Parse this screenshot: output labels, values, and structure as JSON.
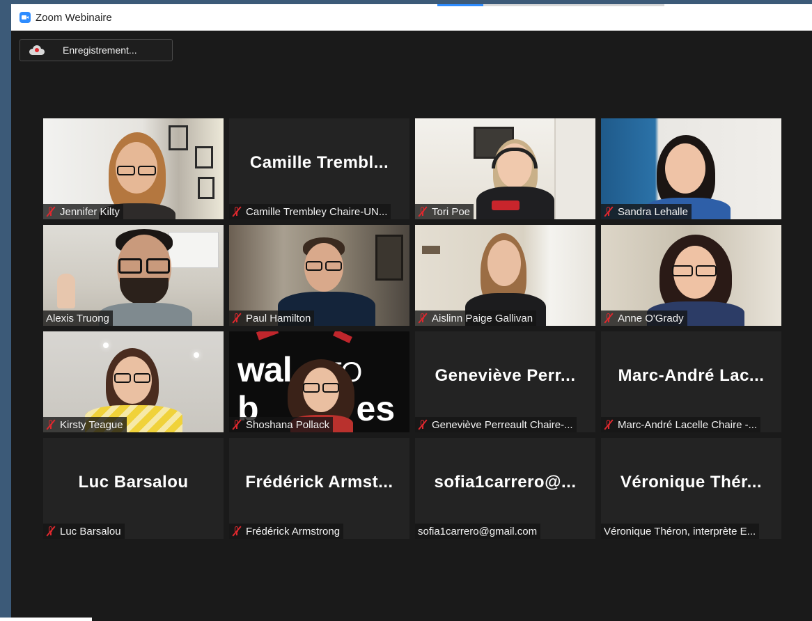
{
  "window": {
    "title": "Zoom Webinaire"
  },
  "recording": {
    "label": "Enregistrement..."
  },
  "participants": [
    {
      "name": "Jennifer Kilty",
      "video": true,
      "muted": true
    },
    {
      "display": "Camille Trembl...",
      "name": "Camille Trembley Chaire-UN...",
      "video": false,
      "muted": true
    },
    {
      "name": "Tori Poe",
      "video": true,
      "muted": true
    },
    {
      "name": "Sandra Lehalle",
      "video": true,
      "muted": true
    },
    {
      "name": "Alexis Truong",
      "video": true,
      "muted": false,
      "active_speaker": true
    },
    {
      "name": "Paul Hamilton",
      "video": true,
      "muted": true
    },
    {
      "name": "Aislinn Paige Gallivan",
      "video": true,
      "muted": true
    },
    {
      "name": "Anne O'Grady",
      "video": true,
      "muted": true
    },
    {
      "name": "Kirsty Teague",
      "video": true,
      "muted": true
    },
    {
      "name": "Shoshana Pollack",
      "video": true,
      "muted": true,
      "background_text": "walls TO bridges"
    },
    {
      "display": "Geneviève  Perr...",
      "name": "Geneviève Perreault Chaire-...",
      "video": false,
      "muted": true
    },
    {
      "display": "Marc-André  Lac...",
      "name": "Marc-André Lacelle Chaire -...",
      "video": false,
      "muted": true
    },
    {
      "display": "Luc Barsalou",
      "name": "Luc Barsalou",
      "video": false,
      "muted": true
    },
    {
      "display": "Frédérick  Armst...",
      "name": "Frédérick Armstrong",
      "video": false,
      "muted": true
    },
    {
      "display": "sofia1carrero@...",
      "name": "sofia1carrero@gmail.com",
      "video": false,
      "muted": false
    },
    {
      "display": "Véronique  Thér...",
      "name": "Véronique Théron, interprète E...",
      "video": false,
      "muted": false
    }
  ],
  "colors": {
    "active_speaker_border": "#d6e35a",
    "mute_icon": "#e0282e",
    "background": "#1a1a1a",
    "tile": "#232323"
  }
}
